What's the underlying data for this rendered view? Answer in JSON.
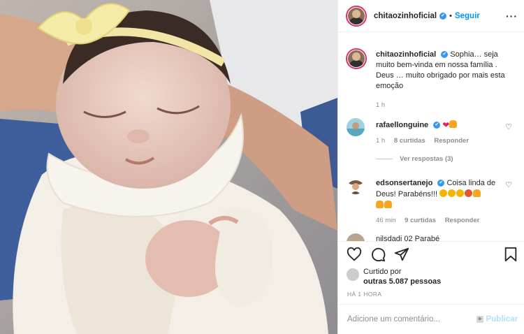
{
  "post": {
    "author": "chitaozinhoficial",
    "verified_badge": "✔",
    "separator": "•",
    "follow_label": "Seguir",
    "more_label": "···"
  },
  "caption": {
    "author": "chitaozinhoficial",
    "text": "Sophia… seja muito bem-vinda em nossa família . Deus … muito obrigado por mais esta emoção",
    "time": "1 h"
  },
  "comments": [
    {
      "author": "rafaellonguine",
      "text": "",
      "emojis": [
        "heart",
        "pray"
      ],
      "time": "1 h",
      "likes": "8 curtidas",
      "reply_label": "Responder",
      "view_replies": "Ver respostas (3)"
    },
    {
      "author": "edsonsertanejo",
      "text": "Coisa linda de Deus! Parabéns!!!",
      "emojis": [
        "clap",
        "clap",
        "clap",
        "boom",
        "pray",
        "pray",
        "pray"
      ],
      "time": "46 min",
      "likes": "9 curtidas",
      "reply_label": "Responder"
    }
  ],
  "peek_comment": {
    "text": "nilsdadi 02 Parabé"
  },
  "actions": {
    "icons": [
      "heart-outline-icon",
      "comment-icon",
      "share-icon",
      "bookmark-icon"
    ]
  },
  "likes": {
    "prefix": "Curtido por",
    "count_text": "outras 5.087 pessoas"
  },
  "timestamp": "HÁ 1 HORA",
  "add_comment": {
    "placeholder": "Adicione um comentário...",
    "publish_label": "Publicar"
  },
  "colors": {
    "accent": "#0095f6",
    "verified": "#3897f0",
    "muted": "#8e8e8e",
    "heart": "#e0245e"
  }
}
